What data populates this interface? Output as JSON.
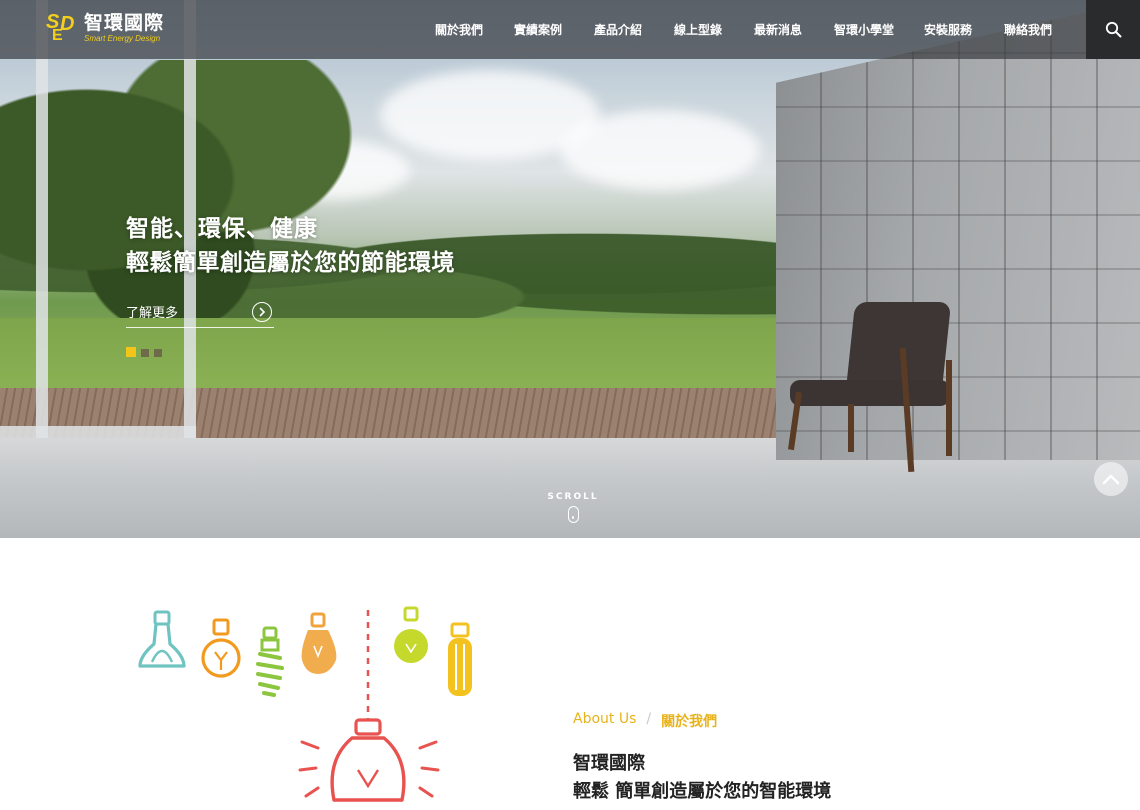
{
  "brand": {
    "logo_name": "智環國際",
    "logo_tagline": "Smart Energy Design",
    "accent_color": "#f3cf1b"
  },
  "nav": {
    "items": [
      {
        "label": "關於我們"
      },
      {
        "label": "實績案例"
      },
      {
        "label": "產品介紹"
      },
      {
        "label": "線上型錄"
      },
      {
        "label": "最新消息"
      },
      {
        "label": "智環小學堂"
      },
      {
        "label": "安裝服務"
      },
      {
        "label": "聯絡我們"
      }
    ],
    "search_icon": "search-icon"
  },
  "hero": {
    "line1": "智能、環保、健康",
    "line2": "輕鬆簡單創造屬於您的節能環境",
    "cta_label": "了解更多",
    "slides_total": 3,
    "active_slide": 1,
    "scroll_label": "SCROLL"
  },
  "about": {
    "crumb_en": "About Us",
    "crumb_sep": "/",
    "crumb_zh": "關於我們",
    "title_line1": "智環國際",
    "title_line2": "輕鬆 簡單創造屬於您的智能環境"
  },
  "colors": {
    "nav_bg": "rgba(60,62,66,0.72)",
    "accent_yellow": "#e8b31a",
    "bulb_teal": "#6fc3c0",
    "bulb_orange": "#f29a1d",
    "bulb_green": "#8cc63f",
    "bulb_amber": "#f0a33a",
    "bulb_lime": "#c5d82c",
    "bulb_yellow": "#f4c21e",
    "bulb_red": "#e8524f"
  }
}
